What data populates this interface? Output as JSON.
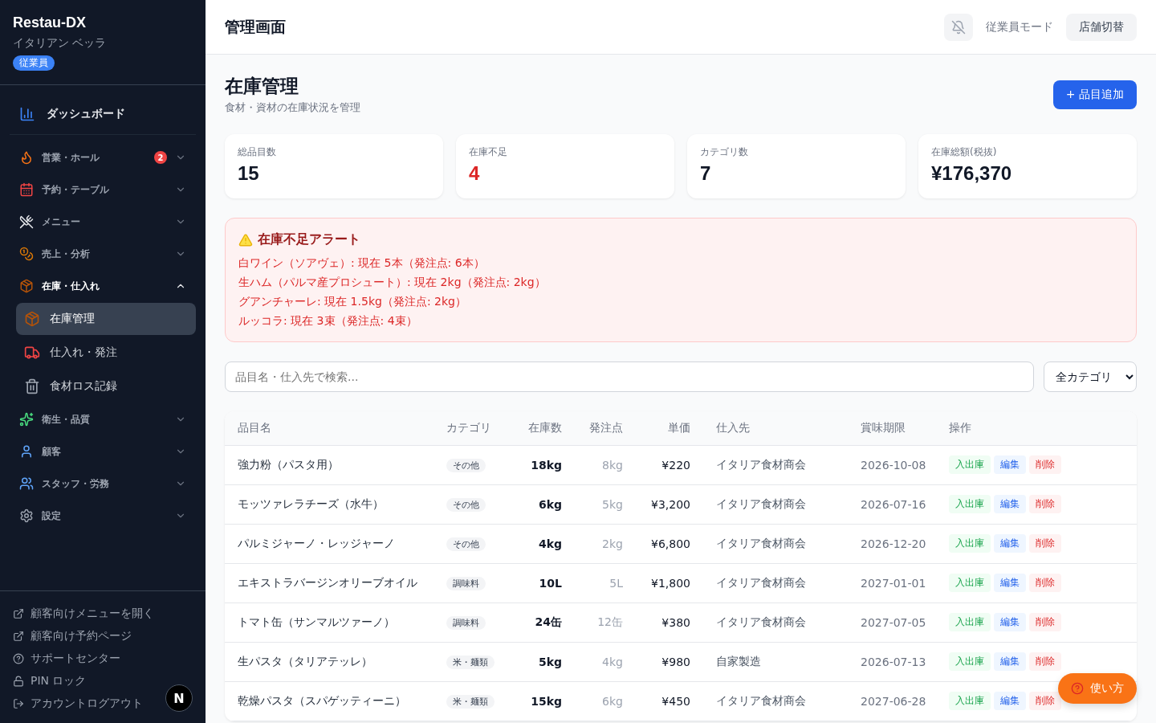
{
  "sidebar": {
    "brand": "Restau-DX",
    "store": "イタリアン ベッラ",
    "role_badge": "従業員",
    "dashboard": {
      "label": "ダッシュボード"
    },
    "groups": [
      {
        "label": "営業・ホール",
        "badge": "2",
        "expanded": false
      },
      {
        "label": "予約・テーブル",
        "expanded": false
      },
      {
        "label": "メニュー",
        "expanded": false
      },
      {
        "label": "売上・分析",
        "expanded": false
      },
      {
        "label": "在庫・仕入れ",
        "expanded": true,
        "children": [
          {
            "label": "在庫管理",
            "selected": true
          },
          {
            "label": "仕入れ・発注",
            "selected": false
          },
          {
            "label": "食材ロス記録",
            "selected": false
          }
        ]
      },
      {
        "label": "衛生・品質",
        "expanded": false
      },
      {
        "label": "顧客",
        "expanded": false
      },
      {
        "label": "スタッフ・労務",
        "expanded": false
      },
      {
        "label": "設定",
        "expanded": false
      }
    ],
    "footer_links": [
      {
        "label": "顧客向けメニューを開く"
      },
      {
        "label": "顧客向け予約ページ"
      },
      {
        "label": "サポートセンター"
      },
      {
        "label": "PIN ロック"
      },
      {
        "label": "アカウントログアウト"
      }
    ],
    "dev_badge": "N"
  },
  "header": {
    "title": "管理画面",
    "mode_label": "従業員モード",
    "switch_button": "店舗切替"
  },
  "page": {
    "title": "在庫管理",
    "subtitle": "食材・資材の在庫状況を管理",
    "add_button": "+ 品目追加"
  },
  "stats": [
    {
      "label": "総品目数",
      "value": "15",
      "alert": false
    },
    {
      "label": "在庫不足",
      "value": "4",
      "alert": true
    },
    {
      "label": "カテゴリ数",
      "value": "7",
      "alert": false
    },
    {
      "label": "在庫総額(税抜)",
      "value": "¥176,370",
      "alert": false
    }
  ],
  "alert": {
    "title": "在庫不足アラート",
    "items": [
      "白ワイン（ソアヴェ）: 現在 5本（発注点: 6本）",
      "生ハム（パルマ産プロシュート）: 現在 2kg（発注点: 2kg）",
      "グアンチャーレ: 現在 1.5kg（発注点: 2kg）",
      "ルッコラ: 現在 3束（発注点: 4束）"
    ]
  },
  "filters": {
    "search_placeholder": "品目名・仕入先で検索...",
    "category_select": "全カテゴリ"
  },
  "table": {
    "columns": [
      "品目名",
      "カテゴリ",
      "在庫数",
      "発注点",
      "単価",
      "仕入先",
      "賞味期限",
      "操作"
    ],
    "rows": [
      {
        "name": "強力粉（パスタ用）",
        "category": "その他",
        "stock": "18kg",
        "reorder": "8kg",
        "price": "¥220",
        "supplier": "イタリア食材商会",
        "expiry": "2026-10-08",
        "actions": [
          "入出庫",
          "編集",
          "削除"
        ]
      },
      {
        "name": "モッツァレラチーズ（水牛）",
        "category": "その他",
        "stock": "6kg",
        "reorder": "5kg",
        "price": "¥3,200",
        "supplier": "イタリア食材商会",
        "expiry": "2026-07-16",
        "actions": [
          "入出庫",
          "編集",
          "削除"
        ]
      },
      {
        "name": "パルミジャーノ・レッジャーノ",
        "category": "その他",
        "stock": "4kg",
        "reorder": "2kg",
        "price": "¥6,800",
        "supplier": "イタリア食材商会",
        "expiry": "2026-12-20",
        "actions": [
          "入出庫",
          "編集",
          "削除"
        ]
      },
      {
        "name": "エキストラバージンオリーブオイル",
        "category": "調味料",
        "stock": "10L",
        "reorder": "5L",
        "price": "¥1,800",
        "supplier": "イタリア食材商会",
        "expiry": "2027-01-01",
        "actions": [
          "入出庫",
          "編集",
          "削除"
        ]
      },
      {
        "name": "トマト缶（サンマルツァーノ）",
        "category": "調味料",
        "stock": "24缶",
        "reorder": "12缶",
        "price": "¥380",
        "supplier": "イタリア食材商会",
        "expiry": "2027-07-05",
        "actions": [
          "入出庫",
          "編集",
          "削除"
        ]
      },
      {
        "name": "生パスタ（タリアテッレ）",
        "category": "米・麺類",
        "stock": "5kg",
        "reorder": "4kg",
        "price": "¥980",
        "supplier": "自家製造",
        "expiry": "2026-07-13",
        "actions": [
          "入出庫",
          "編集",
          "削除"
        ]
      },
      {
        "name": "乾燥パスタ（スパゲッティーニ）",
        "category": "米・麺類",
        "stock": "15kg",
        "reorder": "6kg",
        "price": "¥450",
        "supplier": "イタリア食材商会",
        "expiry": "2027-06-28",
        "actions": [
          "入出庫",
          "編集",
          "削除"
        ]
      }
    ]
  },
  "help_button": "使い方"
}
